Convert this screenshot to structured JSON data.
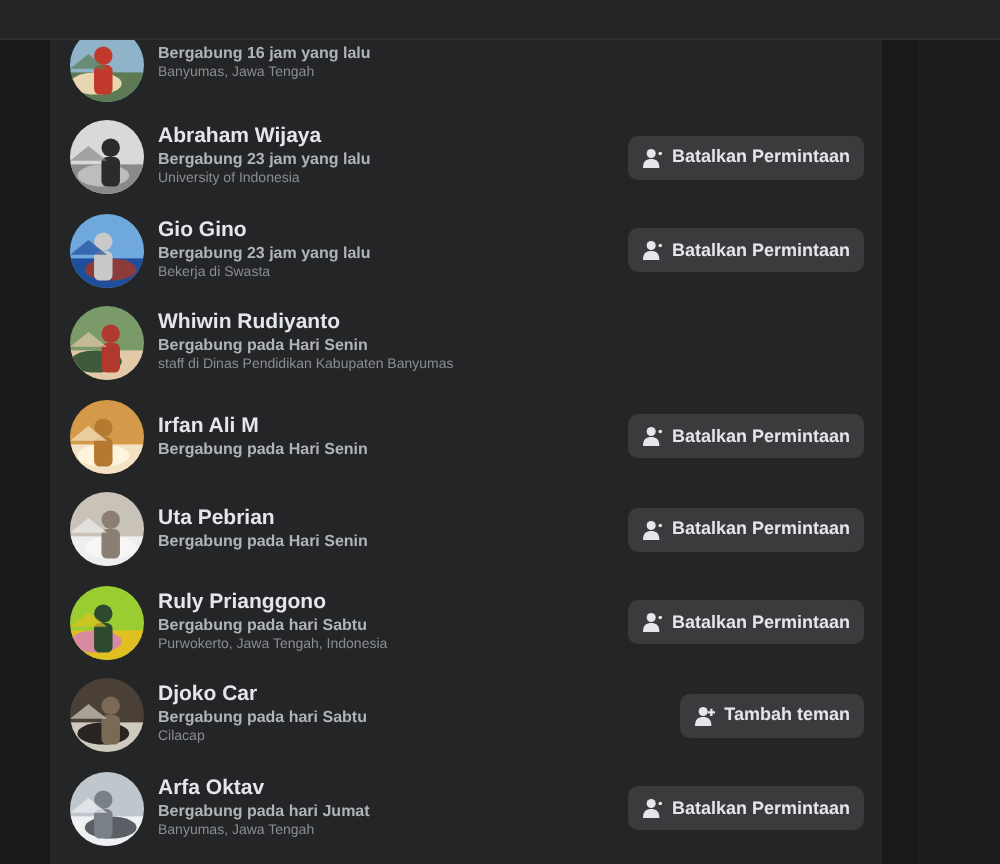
{
  "people": [
    {
      "joined": "Bergabung 16 jam yang lalu",
      "detail": "Banyumas, Jawa Tengah"
    },
    {
      "name": "Abraham Wijaya",
      "joined": "Bergabung 23 jam yang lalu",
      "detail": "University of Indonesia",
      "button": {
        "kind": "cancel",
        "label": "Batalkan Permintaan"
      }
    },
    {
      "name": "Gio Gino",
      "joined": "Bergabung 23 jam yang lalu",
      "detail": "Bekerja di Swasta",
      "button": {
        "kind": "cancel",
        "label": "Batalkan Permintaan"
      }
    },
    {
      "name": "Whiwin Rudiyanto",
      "joined": "Bergabung pada Hari Senin",
      "detail": "staff di Dinas Pendidikan Kabupaten Banyumas"
    },
    {
      "name": "Irfan Ali M",
      "joined": "Bergabung pada Hari Senin",
      "button": {
        "kind": "cancel",
        "label": "Batalkan Permintaan"
      }
    },
    {
      "name": "Uta Pebrian",
      "joined": "Bergabung pada Hari Senin",
      "button": {
        "kind": "cancel",
        "label": "Batalkan Permintaan"
      }
    },
    {
      "name": "Ruly Prianggono",
      "joined": "Bergabung pada hari Sabtu",
      "detail": "Purwokerto, Jawa Tengah, Indonesia",
      "button": {
        "kind": "cancel",
        "label": "Batalkan Permintaan"
      }
    },
    {
      "name": "Djoko Car",
      "joined": "Bergabung pada hari Sabtu",
      "detail": "Cilacap",
      "button": {
        "kind": "add",
        "label": "Tambah teman"
      }
    },
    {
      "name": "Arfa Oktav",
      "joined": "Bergabung pada hari Jumat",
      "detail": "Banyumas, Jawa Tengah",
      "button": {
        "kind": "cancel",
        "label": "Batalkan Permintaan"
      }
    }
  ]
}
